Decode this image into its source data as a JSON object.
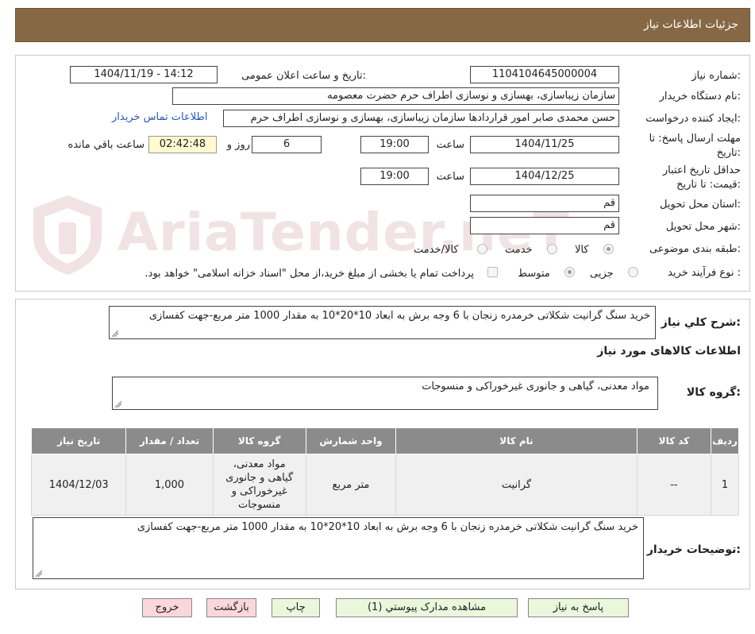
{
  "header": {
    "title": "جزئیات اطلاعات نیاز"
  },
  "watermark": {
    "text": "AriaTender.neT"
  },
  "form": {
    "need_number_label": "شماره نیاز:",
    "need_number": "1104104645000004",
    "announce_label": "تاریخ و ساعت اعلان عمومی:",
    "announce_value": "1404/11/19 - 14:12",
    "buyer_org_label": "نام دستگاه خریدار:",
    "buyer_org": "سازمان زیباسازی، بهسازی و نوسازی اطراف حرم حضرت معصومه",
    "requester_label": "ایجاد کننده درخواست:",
    "requester": "حسن محمدی صابر امور قراردادها سازمان زیباسازی، بهسازی و نوسازی اطراف حرم",
    "contact_link": "اطلاعات تماس خریدار",
    "deadline_label_1": "مهلت ارسال پاسخ: تا",
    "deadline_label_2": "تاریخ:",
    "deadline_date": "1404/11/25",
    "time_label": "ساعت",
    "deadline_time": "19:00",
    "days": "6",
    "days_label": "روز و",
    "remaining_time": "02:42:48",
    "remaining_label": "ساعت باقي مانده",
    "validity_label_1": "حداقل تاریخ اعتبار",
    "validity_label_2": "قیمت: تا تاریخ:",
    "validity_date": "1404/12/25",
    "validity_time": "19:00",
    "province_label": "استان محل تحویل:",
    "province": "قم",
    "city_label": "شهر محل تحویل:",
    "city": "قم",
    "category_label": "طبقه بندی موضوعی:",
    "category_options": [
      "کالا",
      "خدمت",
      "کالا/خدمت"
    ],
    "category_selected": "کالا",
    "process_label": "نوع فرآیند خرید :",
    "process_options": [
      "جزیی",
      "متوسط"
    ],
    "process_selected": "متوسط",
    "treasury_note": "پرداخت تمام یا بخشی از مبلغ خرید،از محل \"اسناد خزانه اسلامی\" خواهد بود."
  },
  "details": {
    "summary_label": "شرح کلي نياز:",
    "summary": "خرید سنگ گرانیت شکلاتی خرمدره زنجان با 6 وجه برش به ابعاد 10*20*10 به مقدار 1000 متر مربع-جهت کفسازی",
    "goods_info_label": "اطلاعات کالاهای مورد نیاز",
    "goods_group_label": "گروه کالا:",
    "goods_group": "مواد معدنی، گیاهی و جانوری غیرخوراکی و منسوجات",
    "table": {
      "headers": [
        "ردیف",
        "کد کالا",
        "نام کالا",
        "واحد شمارش",
        "گروه کالا",
        "تعداد / مقدار",
        "تاریخ نیاز"
      ],
      "rows": [
        {
          "row": "1",
          "code": "--",
          "name": "گرانیت",
          "unit": "متر مربع",
          "group": "مواد معدنی، گیاهی و جانوری غیرخوراکی و منسوجات",
          "qty": "1,000",
          "date": "1404/12/03"
        }
      ]
    },
    "buyer_notes_label": "توضیحات خریدار:",
    "buyer_notes": "خرید سنگ گرانیت شکلاتی خرمدره زنجان با 6 وجه برش به ابعاد 10*20*10 به مقدار 1000 متر مربع-جهت کفسازی"
  },
  "buttons": {
    "respond": "پاسخ به نیاز",
    "attachments": "مشاهده مدارک پیوستي (1)",
    "print": "چاپ",
    "back": "بازگشت",
    "exit": "خروج"
  }
}
